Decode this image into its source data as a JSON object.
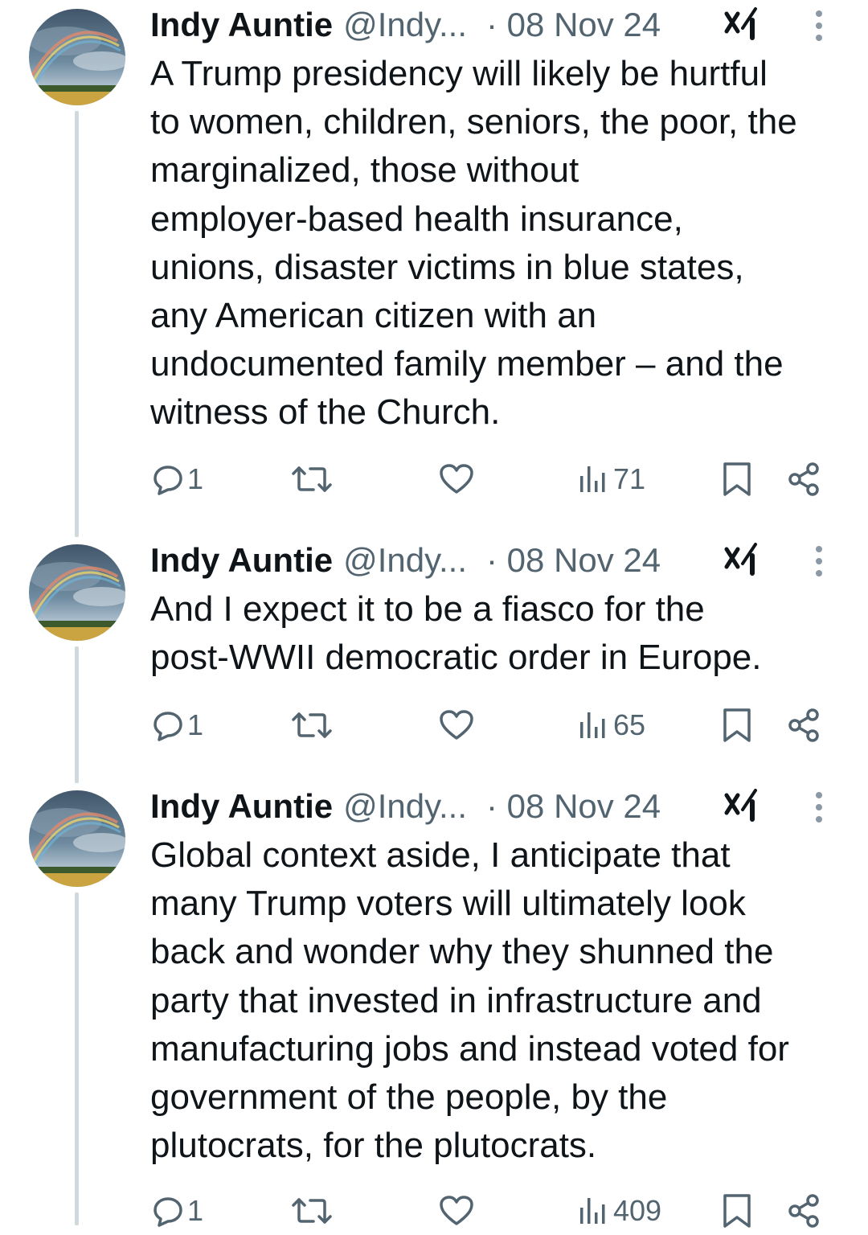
{
  "tweets": [
    {
      "author_name": "Indy Auntie",
      "handle": "@Indy...",
      "date": "· 08 Nov 24",
      "text": "A Trump presidency will likely be hurtful\nto women, children, seniors, the poor, the\nmarginalized, those without\nemployer-based health insurance,\nunions, disaster victims in blue states,\nany American citizen with an\nundocumented family member – and the\nwitness of the Church.",
      "replies": "1",
      "views": "71"
    },
    {
      "author_name": "Indy Auntie",
      "handle": "@Indy...",
      "date": "· 08 Nov 24",
      "text": "And I expect it to be a fiasco for the\npost-WWII democratic order in Europe.",
      "replies": "1",
      "views": "65"
    },
    {
      "author_name": "Indy Auntie",
      "handle": "@Indy...",
      "date": "· 08 Nov 24",
      "text": "Global context aside, I anticipate that\nmany Trump voters will ultimately look\nback and wonder why they shunned the\nparty that invested in infrastructure and\nmanufacturing jobs and instead voted for\ngovernment of the people, by the\nplutocrats, for the plutocrats.",
      "replies": "1",
      "views": "409"
    }
  ],
  "icons": {
    "reply": "reply-icon",
    "repost": "repost-icon",
    "like": "heart-icon",
    "views": "views-icon",
    "bookmark": "bookmark-icon",
    "share": "share-icon",
    "grok": "grok-icon",
    "more": "more-options-icon"
  },
  "colors": {
    "text_primary": "#0f1419",
    "text_secondary": "#536471",
    "thread_line": "#cfd9de"
  }
}
